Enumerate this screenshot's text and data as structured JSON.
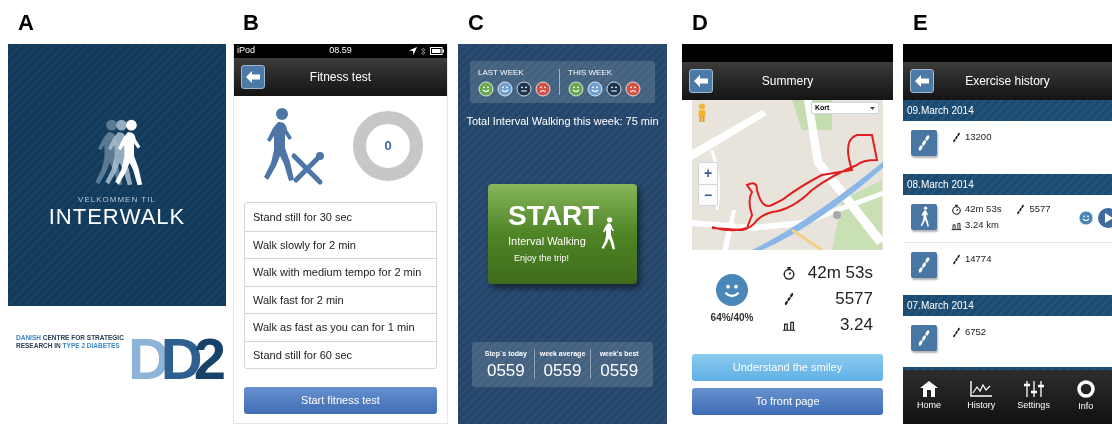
{
  "panel_a": {
    "label": "A",
    "welcome": "VELKOMMEN TIL",
    "app_name": "INTER**WALK**",
    "partner_text": [
      {
        "text": "DANISH",
        "highlight": true
      },
      {
        "text": "CENTRE FOR STRATEGIC RESEARCH IN",
        "highlight": false
      },
      {
        "text": "TYPE 2 DIABETES",
        "highlight": true
      }
    ],
    "partner_logo": "DD2"
  },
  "panel_b": {
    "label": "B",
    "status_bar": {
      "carrier": "iPod",
      "time": "08.59"
    },
    "title": "Fitness test",
    "counter": "0",
    "steps": [
      "Stand still for 30 sec",
      "Walk slowly for 2 min",
      "Walk with medium tempo for 2 min",
      "Walk fast for 2 min",
      "Walk as fast as you can for 1 min",
      "Stand still for 60 sec"
    ],
    "button": "Start fitness test"
  },
  "panel_c": {
    "label": "C",
    "last_week": {
      "label": "LAST WEEK",
      "moods": [
        {
          "kind": "happy",
          "color": "#6aa84f"
        },
        {
          "kind": "happy",
          "color": "#6fa0d0"
        },
        {
          "kind": "neutral",
          "color": "#1e3550"
        },
        {
          "kind": "sad",
          "color": "#d25248"
        }
      ]
    },
    "this_week": {
      "label": "THIS WEEK",
      "moods": [
        {
          "kind": "happy",
          "color": "#6aa84f"
        },
        {
          "kind": "happy",
          "color": "#6fa0d0"
        },
        {
          "kind": "neutral",
          "color": "#1e3550"
        },
        {
          "kind": "sad",
          "color": "#d25248"
        }
      ]
    },
    "total": "Total Interval Walking this week:  75 min",
    "start_button": {
      "title": "START",
      "subtitle": "Interval Walking",
      "tagline": "Enjoy the trip!"
    },
    "stats": [
      {
        "label": "Step´s today",
        "value": "0559"
      },
      {
        "label": "week average",
        "value": "0559"
      },
      {
        "label": "week's best",
        "value": "0559"
      }
    ]
  },
  "panel_d": {
    "label": "D",
    "title": "Summery",
    "map": {
      "layer_select": "Kort",
      "zoom_in": "+",
      "zoom_out": "−"
    },
    "score": "64%/40%",
    "stats": [
      {
        "kind": "time",
        "value": "42m 53s"
      },
      {
        "kind": "steps",
        "value": "5577"
      },
      {
        "kind": "distance",
        "value": "3.24"
      }
    ],
    "buttons": [
      {
        "label": "Understand the smiley",
        "kind": "light"
      },
      {
        "label": "To front page",
        "kind": "primary"
      }
    ]
  },
  "panel_e": {
    "label": "E",
    "title": "Exercise history",
    "days": [
      {
        "date": "09.March 2014",
        "entries": [
          {
            "kind": "steps",
            "steps": "13200"
          }
        ]
      },
      {
        "date": "08.March 2014",
        "entries": [
          {
            "kind": "walk",
            "time": "42m 53s",
            "steps": "5577",
            "distance": "3.24 km"
          },
          {
            "kind": "steps",
            "steps": "14774"
          }
        ]
      },
      {
        "date": "07.March 2014",
        "entries": [
          {
            "kind": "steps",
            "steps": "6752"
          }
        ]
      }
    ],
    "nav": [
      {
        "label": "Home",
        "kind": "home",
        "selected": false
      },
      {
        "label": "History",
        "kind": "history",
        "selected": false
      },
      {
        "label": "Settings",
        "kind": "settings",
        "selected": false
      },
      {
        "label": "Info",
        "kind": "info",
        "selected": false
      }
    ]
  }
}
